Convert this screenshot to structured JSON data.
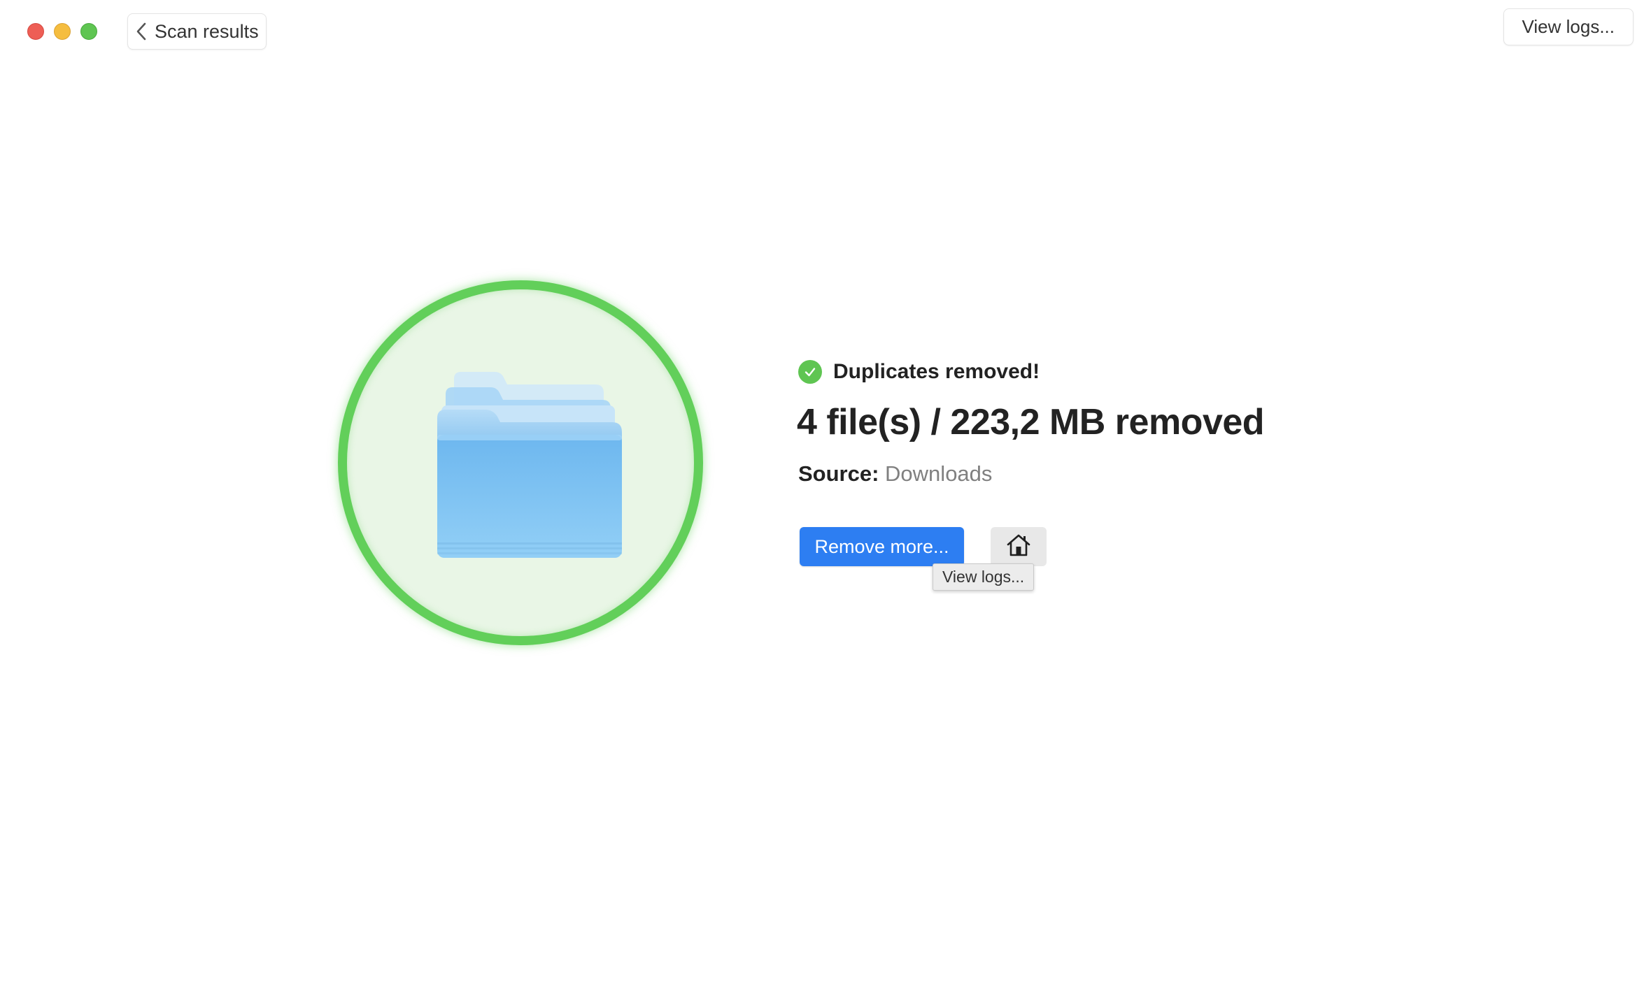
{
  "window": {
    "controls": [
      "close",
      "minimize",
      "maximize"
    ]
  },
  "toolbar": {
    "back_label": "Scan results",
    "back_icon": "chevron-left-icon",
    "view_logs_label": "View logs..."
  },
  "illustration": {
    "icon": "folder-icon",
    "ring_color": "#62cf5a",
    "fill_color": "#e9f6e6"
  },
  "result": {
    "status": "Duplicates removed!",
    "status_icon": "check-circle-icon",
    "headline": "4 file(s) / 223,2 MB removed",
    "source_label": "Source:",
    "source_value": "Downloads"
  },
  "actions": {
    "remove_more_label": "Remove more...",
    "home_icon": "home-icon",
    "tooltip": "View logs..."
  },
  "colors": {
    "accent": "#2d7ef2",
    "success": "#5fc552"
  }
}
